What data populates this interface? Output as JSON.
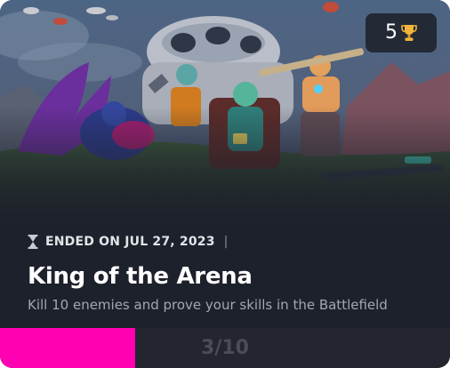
{
  "card": {
    "reward": {
      "count": "5",
      "icon": "trophy-icon"
    },
    "status": {
      "icon": "hourglass-icon",
      "text": "ENDED ON JUL 27, 2023",
      "separator": "|"
    },
    "title": "King of the Arena",
    "description": "Kill 10 enemies and prove your skills in the Battlefield",
    "progress": {
      "label": "3/10",
      "current": 3,
      "total": 10,
      "fill_color": "#ff00b3"
    }
  },
  "colors": {
    "card_background": "#1d212b",
    "progress_track": "#23262f",
    "accent": "#ff00b3",
    "trophy": "#f2b43a"
  }
}
